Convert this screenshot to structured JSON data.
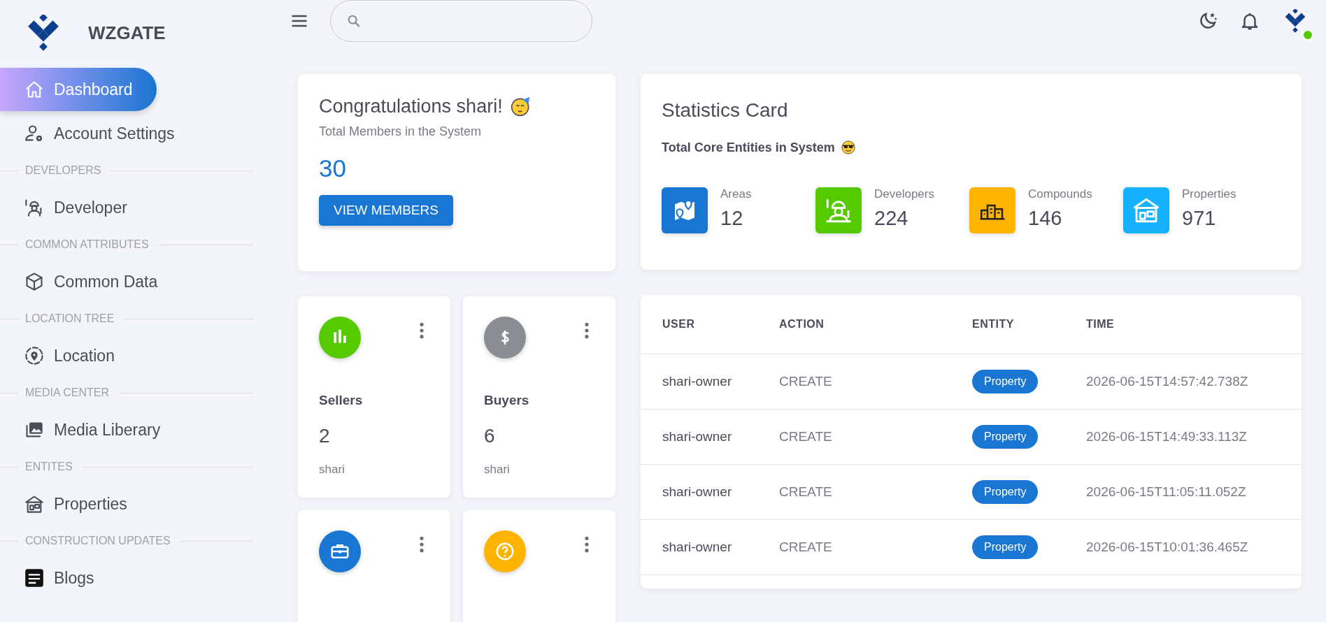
{
  "brand": {
    "name": "WZGATE"
  },
  "sidebar": {
    "items": [
      {
        "kind": "link",
        "label": "Dashboard",
        "selected": true
      },
      {
        "kind": "link",
        "label": "Account Settings",
        "selected": false
      },
      {
        "kind": "section",
        "label": "DEVELOPERS"
      },
      {
        "kind": "link",
        "label": "Developer",
        "selected": false
      },
      {
        "kind": "section",
        "label": "COMMON ATTRIBUTES"
      },
      {
        "kind": "link",
        "label": "Common Data",
        "selected": false
      },
      {
        "kind": "section",
        "label": "LOCATION TREE"
      },
      {
        "kind": "link",
        "label": "Location",
        "selected": false
      },
      {
        "kind": "section",
        "label": "MEDIA CENTER"
      },
      {
        "kind": "link",
        "label": "Media Liberary",
        "selected": false
      },
      {
        "kind": "section",
        "label": "ENTITES"
      },
      {
        "kind": "link",
        "label": "Properties",
        "selected": false
      },
      {
        "kind": "section",
        "label": "CONSTRUCTION UPDATES"
      },
      {
        "kind": "link",
        "label": "Blogs",
        "selected": false
      }
    ]
  },
  "header": {
    "user": {
      "online": true
    }
  },
  "welcome": {
    "title": "Congratulations shari!",
    "subtitle": "Total Members in the System",
    "count": "30",
    "button": "VIEW MEMBERS"
  },
  "summary_cards": [
    {
      "title": "Sellers",
      "value": "2",
      "owner": "shari",
      "color": "#56ca00"
    },
    {
      "title": "Buyers",
      "value": "6",
      "owner": "shari",
      "color": "#8a8d93"
    },
    {
      "color": "#1976d2"
    },
    {
      "color": "#ffb400"
    }
  ],
  "statistics": {
    "title": "Statistics Card",
    "subtitle": "Total Core Entities in System",
    "items": [
      {
        "label": "Areas",
        "value": "12",
        "color": "#1976d2"
      },
      {
        "label": "Developers",
        "value": "224",
        "color": "#56ca00"
      },
      {
        "label": "Compounds",
        "value": "146",
        "color": "#ffb400"
      },
      {
        "label": "Properties",
        "value": "971",
        "color": "#16b1ff"
      }
    ]
  },
  "activity_table": {
    "columns": [
      "USER",
      "ACTION",
      "ENTITY",
      "TIME"
    ],
    "rows": [
      {
        "user": "shari-owner",
        "action": "CREATE",
        "entity": "Property",
        "time": "2026-06-15T14:57:42.738Z"
      },
      {
        "user": "shari-owner",
        "action": "CREATE",
        "entity": "Property",
        "time": "2026-06-15T14:49:33.113Z"
      },
      {
        "user": "shari-owner",
        "action": "CREATE",
        "entity": "Property",
        "time": "2026-06-15T11:05:11.052Z"
      },
      {
        "user": "shari-owner",
        "action": "CREATE",
        "entity": "Property",
        "time": "2026-06-15T10:01:36.465Z"
      }
    ]
  }
}
